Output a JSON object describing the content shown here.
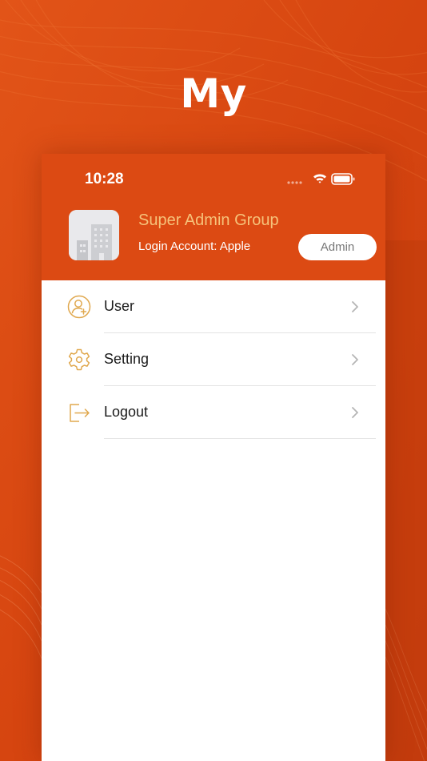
{
  "promo": {
    "title": "My"
  },
  "status_bar": {
    "time": "10:28"
  },
  "profile": {
    "org_name": "Super Admin Group",
    "login_account": "Login Account: Apple",
    "role": "Admin"
  },
  "menu": {
    "items": [
      {
        "label": "User",
        "icon": "user-add-icon"
      },
      {
        "label": "Setting",
        "icon": "gear-icon"
      },
      {
        "label": "Logout",
        "icon": "logout-icon"
      }
    ]
  },
  "colors": {
    "brand_orange": "#dc4a13",
    "org_name_gold": "#f6c27a",
    "icon_gold": "#e0a84e"
  }
}
